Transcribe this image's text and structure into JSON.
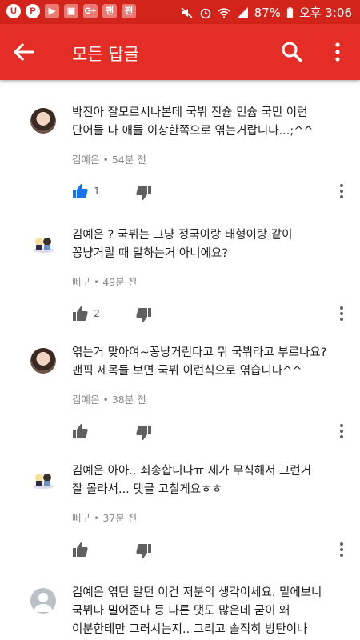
{
  "status_bar": {
    "battery_percent": "87%",
    "time": "오후 3:06",
    "icons": [
      "u-app-icon",
      "p-app-icon",
      "youtube-icon",
      "gallery-icon",
      "gplus-icon",
      "fanfan-icon",
      "fanfan-icon",
      "mute-icon",
      "alarm-icon",
      "wifi-icon",
      "signal-icon",
      "battery-icon"
    ],
    "app_icon_labels": [
      "G+",
      "팬",
      "팬"
    ]
  },
  "app_bar": {
    "title": "모든 답글",
    "color": "#e52d27"
  },
  "comments": [
    {
      "avatar": "photo",
      "text": "박진아 잘모르시나본데 국뷔 진슙 민슙 국민 이런\n단어들 다 애들 이상한쪽으로 엮는거랍니다...;^^",
      "meta": "김예은 • 54분 전",
      "likes": "1",
      "liked": true
    },
    {
      "avatar": "sticker",
      "text": "김예은 ? 국뷔는 그냥 정국이랑 태형이랑 같이\n꽁냥거릴 때 말하는거 아니에요?",
      "meta": "삐구 • 49분 전",
      "likes": "2",
      "liked": false
    },
    {
      "avatar": "photo",
      "text": "엮는거 맞아여~꽁냥거린다고 뭐 국뷔라고 부르나요?\n팬픽 제목들 보면 국뷔 이런식으로 엮습니다^^",
      "meta": "김예은 • 38분 전",
      "likes": "",
      "liked": false
    },
    {
      "avatar": "sticker",
      "text": "김예은 아아.. 죄송합니다ㅠ 제가 무식해서 그런거\n잘 몰라서... 댓글 고칠게요ㅎㅎ",
      "meta": "삐구 • 37분 전",
      "likes": "",
      "liked": false
    },
    {
      "avatar": "default",
      "text": "김예은 엮던 말던 이건 저분의 생각이세요. 밑에보니\n국뷔다 밀어준다 등 다른 댓도 많은데 굳이 왜\n이분한테만 그러시는지.. 그리고 솔직히 방탄이나",
      "meta": "",
      "likes": "",
      "liked": false
    }
  ]
}
